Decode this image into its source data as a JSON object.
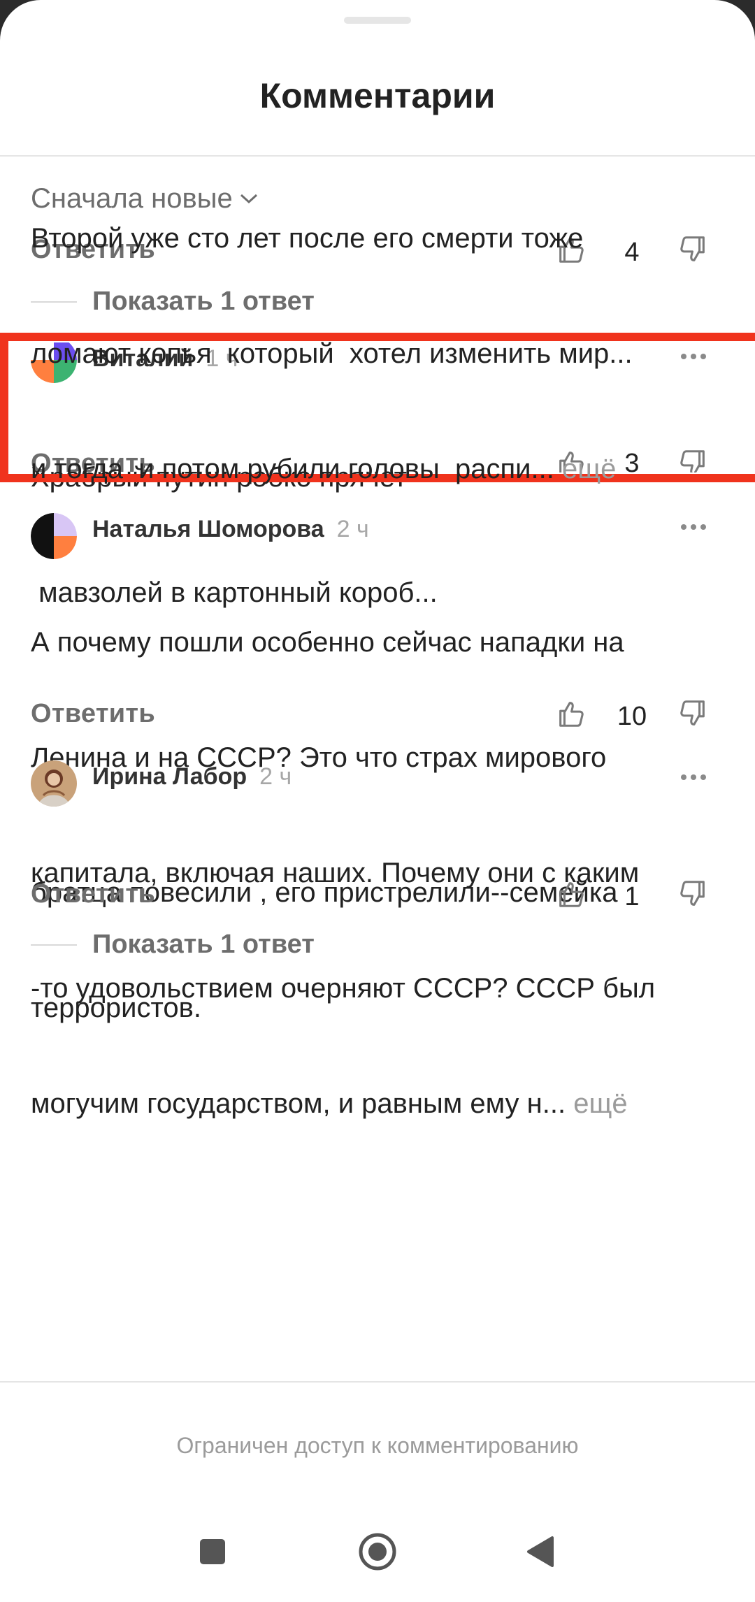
{
  "header": {
    "title": "Комментарии"
  },
  "sort": {
    "label": "Сначала новые"
  },
  "comments": [
    {
      "author": "",
      "time": "",
      "lines": [
        "Второй уже сто лет после его смерти тоже",
        "ломают копья  который  хотел изменить мир...",
        "и тогда  и потом рубили головы  распи... "
      ],
      "more": "ещё",
      "reply": "Ответить",
      "likes": "4"
    },
    {
      "author": "Виталий",
      "time": "1 ч",
      "lines": [
        "Храбрый путин робко прячет",
        " мавзолей в картонный короб..."
      ],
      "more": "",
      "reply": "Ответить",
      "likes": "3"
    },
    {
      "author": "Наталья Шоморова",
      "time": "2 ч",
      "lines": [
        "А почему пошли особенно сейчас нападки на",
        "Ленина и на СССР? Это что страх мирового",
        "капитала, включая наших. Почему они с каким",
        "-то удовольствием очерняют СССР? СССР был",
        "могучим государством, и равным ему н... "
      ],
      "more": "ещё",
      "reply": "Ответить",
      "likes": "10"
    },
    {
      "author": "Ирина Лабор",
      "time": "2 ч",
      "lines": [
        "братца повесили , его пристрелили--семейка",
        "террористов."
      ],
      "more": "",
      "reply": "Ответить",
      "likes": "1"
    }
  ],
  "show_replies": [
    "Показать 1 ответ",
    "Показать 1 ответ"
  ],
  "footer": {
    "restricted": "Ограничен доступ к комментированию"
  },
  "icons": [
    "chevron-down-icon",
    "like-icon",
    "dislike-icon",
    "more-dots-icon",
    "nav-recents-icon",
    "nav-home-icon",
    "nav-back-icon"
  ],
  "colors": {
    "highlight": "#f0331d",
    "muted": "#6d6d6d"
  }
}
